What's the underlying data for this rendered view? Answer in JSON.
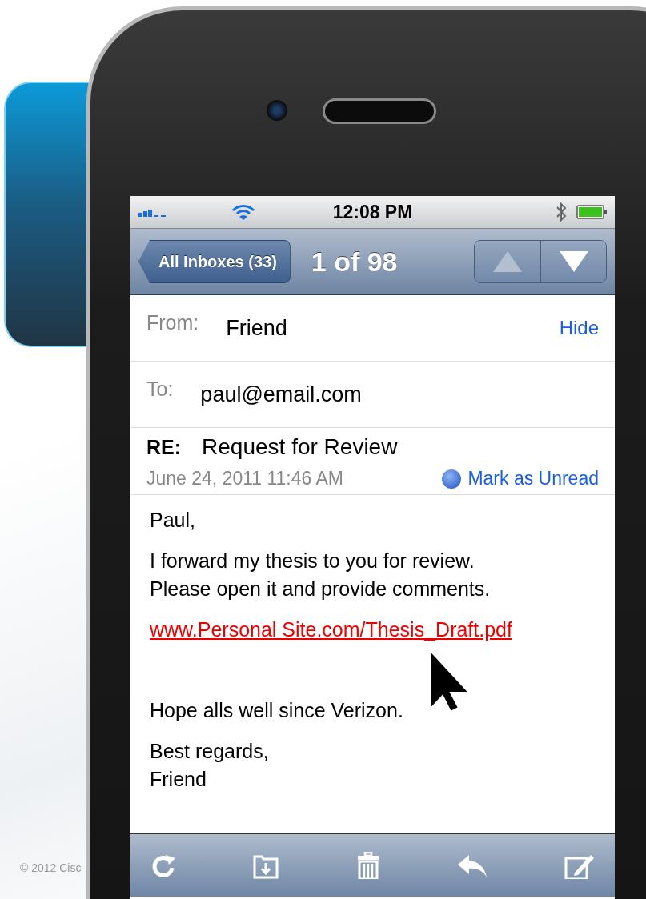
{
  "footer": "© 2012 Cisc",
  "status_bar": {
    "time": "12:08 PM"
  },
  "nav": {
    "back_button": "All Inboxes (33)",
    "position": "1 of 98",
    "arrows": [
      {
        "kind": "up",
        "disabled": true
      },
      {
        "kind": "down",
        "disabled": false
      }
    ]
  },
  "header": {
    "from_label": "From:",
    "from": "Friend",
    "hide": "Hide",
    "to_label": "To:",
    "to": "paul@email.com",
    "subject_label": "RE:",
    "subject": "Request for Review",
    "date": "June 24, 2011 11:46 AM",
    "mark_unread": "Mark as Unread"
  },
  "body": [
    {
      "kind": "text",
      "lines": [
        "Paul,"
      ]
    },
    {
      "kind": "text",
      "lines": [
        "I forward my thesis to you for review.",
        "Please open it and provide comments."
      ]
    },
    {
      "kind": "link",
      "lines": [
        "www.Personal Site.com/Thesis_Draft.pdf"
      ]
    },
    {
      "kind": "spacer"
    },
    {
      "kind": "text",
      "lines": [
        "Hope alls well since Verizon."
      ]
    },
    {
      "kind": "text",
      "lines": [
        "Best regards,",
        "Friend"
      ]
    }
  ]
}
